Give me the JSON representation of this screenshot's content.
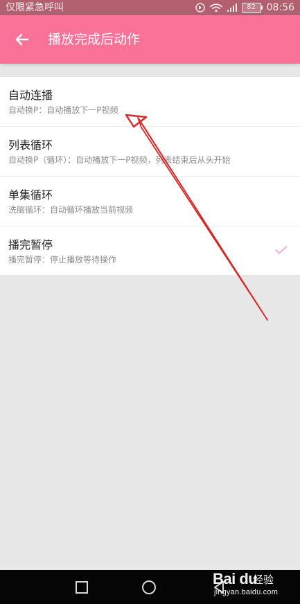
{
  "status_bar": {
    "carrier": "仅限紧急呼叫",
    "battery": "82",
    "time": "08:56"
  },
  "header": {
    "title": "播放完成后动作",
    "back_icon": "arrow-left-icon"
  },
  "options": [
    {
      "title": "自动连播",
      "description": "自动换P：自动播放下一P视频",
      "selected": false
    },
    {
      "title": "列表循环",
      "description": "自动换P（循环）：自动播放下一P视频，列表结束后从头开始",
      "selected": false
    },
    {
      "title": "单集循环",
      "description": "洗脑循环：自动循环播放当前视频",
      "selected": false
    },
    {
      "title": "播完暂停",
      "description": "播完暂停：停止播放等待操作",
      "selected": true
    }
  ],
  "watermark": {
    "logo": "Bai du",
    "label": "经验",
    "url": "jingyan.baidu.com"
  },
  "colors": {
    "accent": "#fb7299",
    "status_bar": "#b2606f",
    "background": "#e8e7e7",
    "check": "#f3a8bd",
    "annotation": "#d62828"
  }
}
